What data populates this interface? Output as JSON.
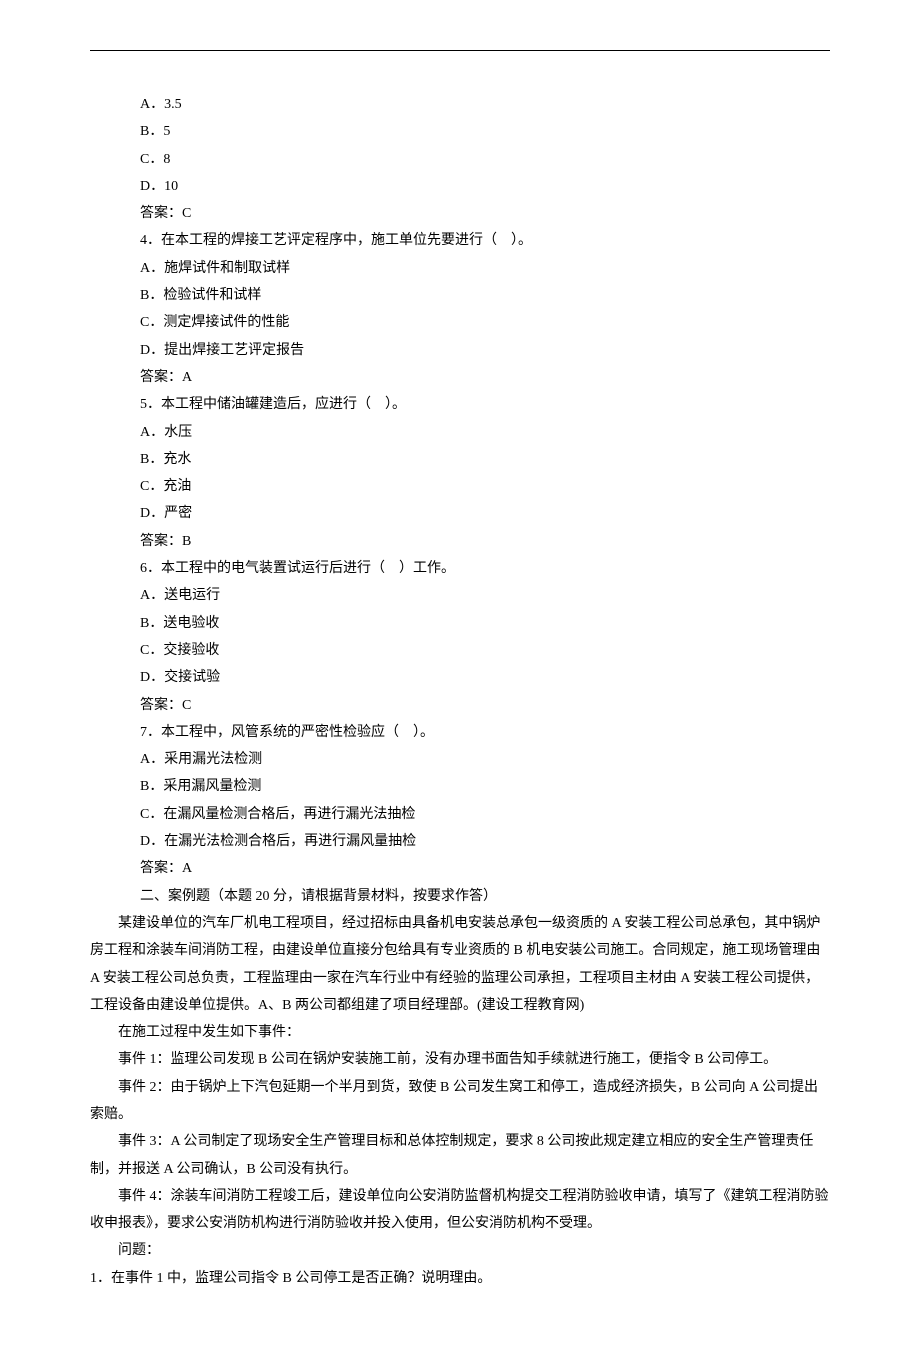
{
  "q3": {
    "optA": "A．3.5",
    "optB": "B．5",
    "optC": "C．8",
    "optD": "D．10",
    "ans": "答案：C"
  },
  "q4": {
    "stem": "4．在本工程的焊接工艺评定程序中，施工单位先要进行（　）。",
    "optA": "A．施焊试件和制取试样",
    "optB": "B．检验试件和试样",
    "optC": "C．测定焊接试件的性能",
    "optD": "D．提出焊接工艺评定报告",
    "ans": "答案：A"
  },
  "q5": {
    "stem": "5．本工程中储油罐建造后，应进行（　）。",
    "optA": "A．水压",
    "optB": "B．充水",
    "optC": "C．充油",
    "optD": "D．严密",
    "ans": "答案：B"
  },
  "q6": {
    "stem": "6．本工程中的电气装置试运行后进行（　）工作。",
    "optA": "A．送电运行",
    "optB": "B．送电验收",
    "optC": "C．交接验收",
    "optD": "D．交接试验",
    "ans": "答案：C"
  },
  "q7": {
    "stem": "7．本工程中，风管系统的严密性检验应（　）。",
    "optA": "A．采用漏光法检测",
    "optB": "B．采用漏风量检测",
    "optC": "C．在漏风量检测合格后，再进行漏光法抽检",
    "optD": "D．在漏光法检测合格后，再进行漏风量抽检",
    "ans": "答案：A"
  },
  "section2": {
    "heading": "二、案例题（本题 20 分，请根据背景材料，按要求作答）",
    "p1": "某建设单位的汽车厂机电工程项目，经过招标由具备机电安装总承包一级资质的 A 安装工程公司总承包，其中锅炉房工程和涂装车间消防工程，由建设单位直接分包给具有专业资质的 B 机电安装公司施工。合同规定，施工现场管理由 A 安装工程公司总负责，工程监理由一家在汽车行业中有经验的监理公司承担，工程项目主材由 A 安装工程公司提供，工程设备由建设单位提供。A、B 两公司都组建了项目经理部。(建设工程教育网)",
    "p2": "在施工过程中发生如下事件：",
    "p3": "事件 1：监理公司发现 B 公司在锅炉安装施工前，没有办理书面告知手续就进行施工，便指令 B 公司停工。",
    "p4": "事件 2：由于锅炉上下汽包延期一个半月到货，致使 B 公司发生窝工和停工，造成经济损失，B 公司向 A 公司提出索赔。",
    "p5": "事件 3：A 公司制定了现场安全生产管理目标和总体控制规定，要求 8 公司按此规定建立相应的安全生产管理责任制，并报送 A 公司确认，B 公司没有执行。",
    "p6": "事件 4：涂装车间消防工程竣工后，建设单位向公安消防监督机构提交工程消防验收申请，填写了《建筑工程消防验收申报表》，要求公安消防机构进行消防验收并投入使用，但公安消防机构不受理。",
    "p7": "问题：",
    "q1": "1．在事件 1 中，监理公司指令 B 公司停工是否正确？说明理由。"
  }
}
